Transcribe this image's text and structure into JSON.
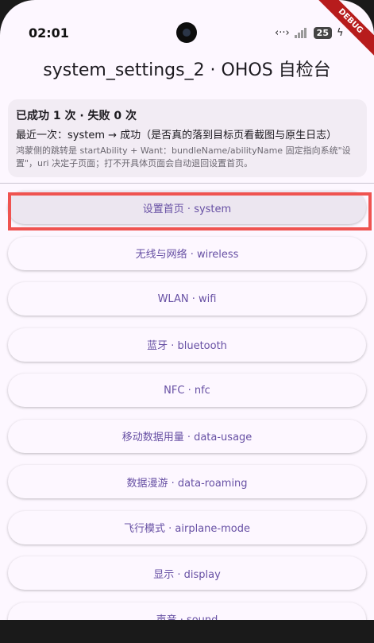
{
  "status_bar": {
    "time": "02:01",
    "battery": "25",
    "debug_banner": "DEBUG"
  },
  "app_title": "system_settings_2 · OHOS 自检台",
  "summary": {
    "title": "已成功 1 次 · 失败 0 次",
    "last": "最近一次：system → 成功（是否真的落到目标页看截图与原生日志）",
    "note": "鸿蒙侧的跳转是 startAbility + Want：bundleName/abilityName 固定指向系统\"设置\"，uri 决定子页面；打不开具体页面会自动退回设置首页。"
  },
  "items": [
    {
      "label": "设置首页",
      "key": "system"
    },
    {
      "label": "无线与网络",
      "key": "wireless"
    },
    {
      "label": "WLAN",
      "key": "wifi"
    },
    {
      "label": "蓝牙",
      "key": "bluetooth"
    },
    {
      "label": "NFC",
      "key": "nfc"
    },
    {
      "label": "移动数据用量",
      "key": "data-usage"
    },
    {
      "label": "数据漫游",
      "key": "data-roaming"
    },
    {
      "label": "飞行模式",
      "key": "airplane-mode"
    },
    {
      "label": "显示",
      "key": "display"
    },
    {
      "label": "声音",
      "key": "sound"
    }
  ],
  "separator": " · ",
  "colors": {
    "accent": "#6750a4",
    "highlight": "#ef5350",
    "background": "#fdf7ff"
  }
}
